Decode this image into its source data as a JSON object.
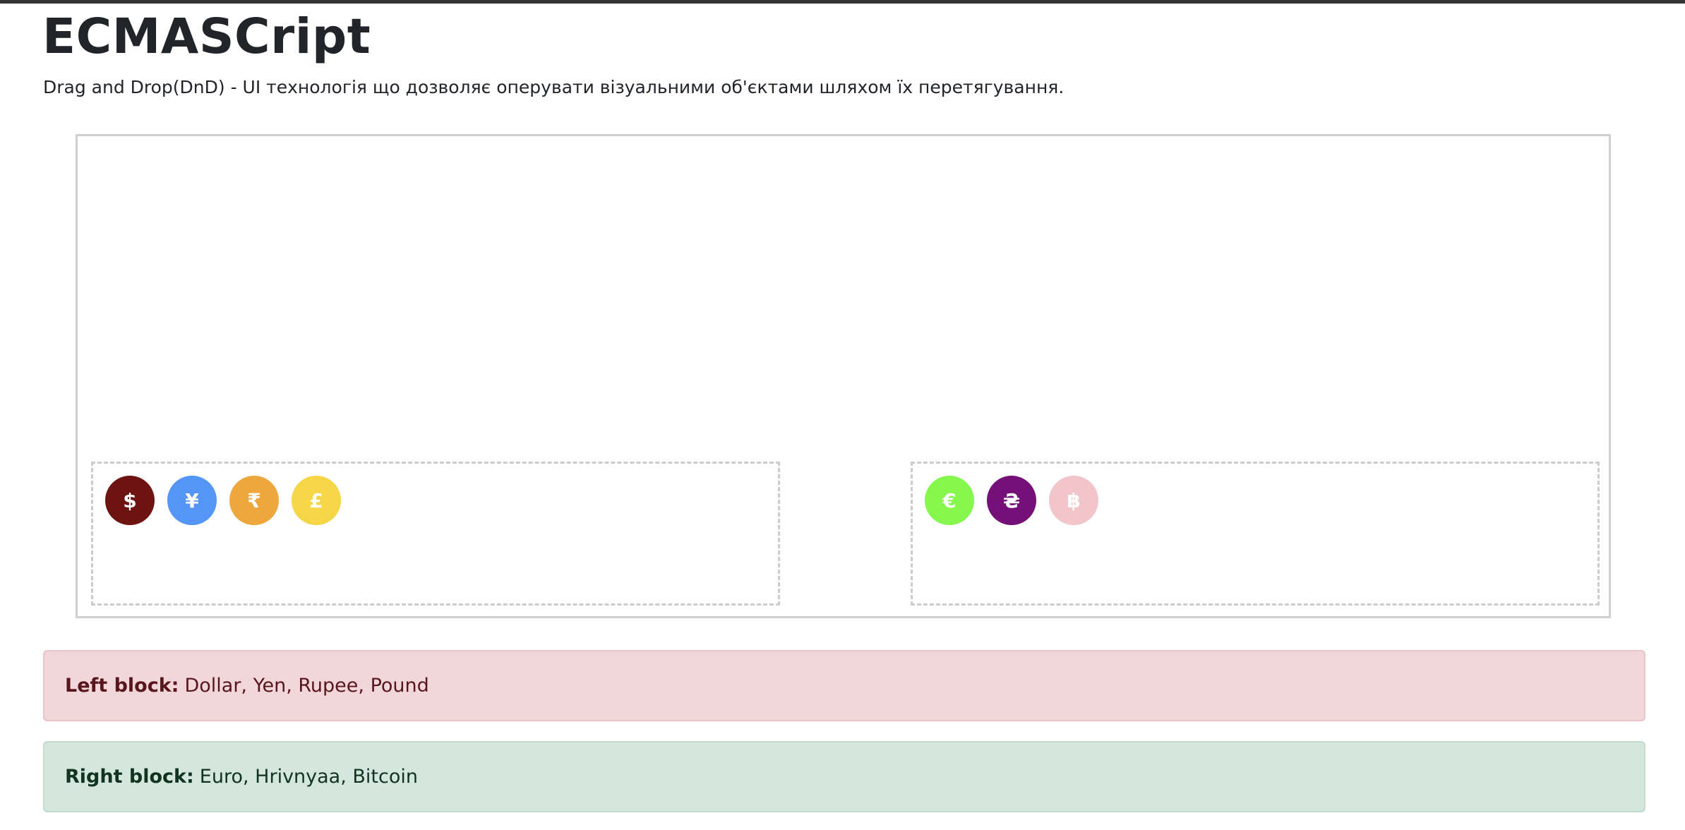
{
  "header": {
    "title": "ECMASCript",
    "description": "Drag and Drop(DnD) - UI технологія що дозволяє оперувати візуальними об'єктами шляхом їх перетягування."
  },
  "left_zone": {
    "coins": [
      {
        "symbol": "$",
        "color": "#6e1410",
        "icon": "dollar-coin"
      },
      {
        "symbol": "¥",
        "color": "#5595f5",
        "icon": "yen-coin"
      },
      {
        "symbol": "₹",
        "color": "#eda73d",
        "icon": "rupee-coin"
      },
      {
        "symbol": "£",
        "color": "#f4d647",
        "icon": "pound-coin"
      }
    ]
  },
  "right_zone": {
    "coins": [
      {
        "symbol": "€",
        "color": "#86f84d",
        "icon": "euro-coin"
      },
      {
        "symbol": "₴",
        "color": "#761079",
        "icon": "hryvnia-coin"
      },
      {
        "symbol": "฿",
        "color": "#f2c5cb",
        "icon": "bitcoin-coin"
      }
    ]
  },
  "results": {
    "left_label": "Left block:",
    "left_value": "Dollar, Yen, Rupee, Pound",
    "right_label": "Right block:",
    "right_value": "Euro, Hrivnyaa, Bitcoin"
  },
  "colors": {
    "danger_bg": "#f1d7da",
    "success_bg": "#d4e6dd"
  }
}
